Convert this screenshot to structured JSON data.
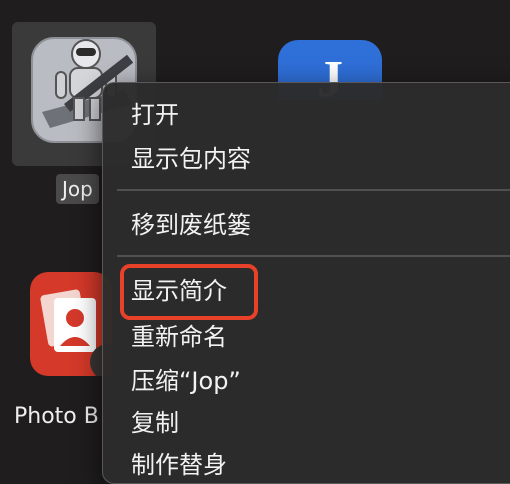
{
  "desktop": {
    "items": [
      {
        "label": "Jop",
        "icon": "automator-icon",
        "selected": true
      },
      {
        "label": "",
        "icon": "jop-app-icon",
        "letter": "J"
      },
      {
        "label": "Photo B",
        "icon": "photo-booth-icon"
      }
    ]
  },
  "context_menu": {
    "groups": [
      [
        {
          "label": "打开"
        },
        {
          "label": "显示包内容"
        }
      ],
      [
        {
          "label": "移到废纸篓"
        }
      ],
      [
        {
          "label": "显示简介",
          "highlighted": true
        },
        {
          "label": "重新命名"
        },
        {
          "label": "压缩“Jop”"
        },
        {
          "label": "复制"
        },
        {
          "label": "制作替身"
        }
      ]
    ]
  },
  "colors": {
    "background": "#1f1d1d",
    "menu_background": "#2c2b2b",
    "highlight_border": "#e8412a",
    "jop_blue": "#2f6fd8"
  }
}
